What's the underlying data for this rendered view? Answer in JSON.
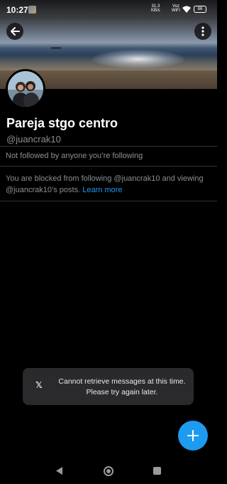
{
  "status_bar": {
    "time": "10:27",
    "net_speed_top": "31.3",
    "net_speed_unit": "KB/s",
    "carrier_top": "Voz",
    "carrier_bottom": "WiFi",
    "battery": "86"
  },
  "profile": {
    "name": "Pareja stgo centro",
    "handle": "@juancrak10",
    "followed_note": "Not followed by anyone you’re following",
    "blocked_text": "You are blocked from following @juancrak10 and viewing @juancrak10’s posts.",
    "learn_more": "Learn more"
  },
  "toast": {
    "logo": "𝕏",
    "line1": "Cannot retrieve messages at this time.",
    "line2": "Please try again later."
  },
  "icons": {
    "back": "arrow-left-icon",
    "more": "more-vertical-icon",
    "fab": "plus-icon"
  },
  "colors": {
    "accent": "#1d9bf0",
    "background": "#000000",
    "secondary_text": "#8b8f94"
  }
}
